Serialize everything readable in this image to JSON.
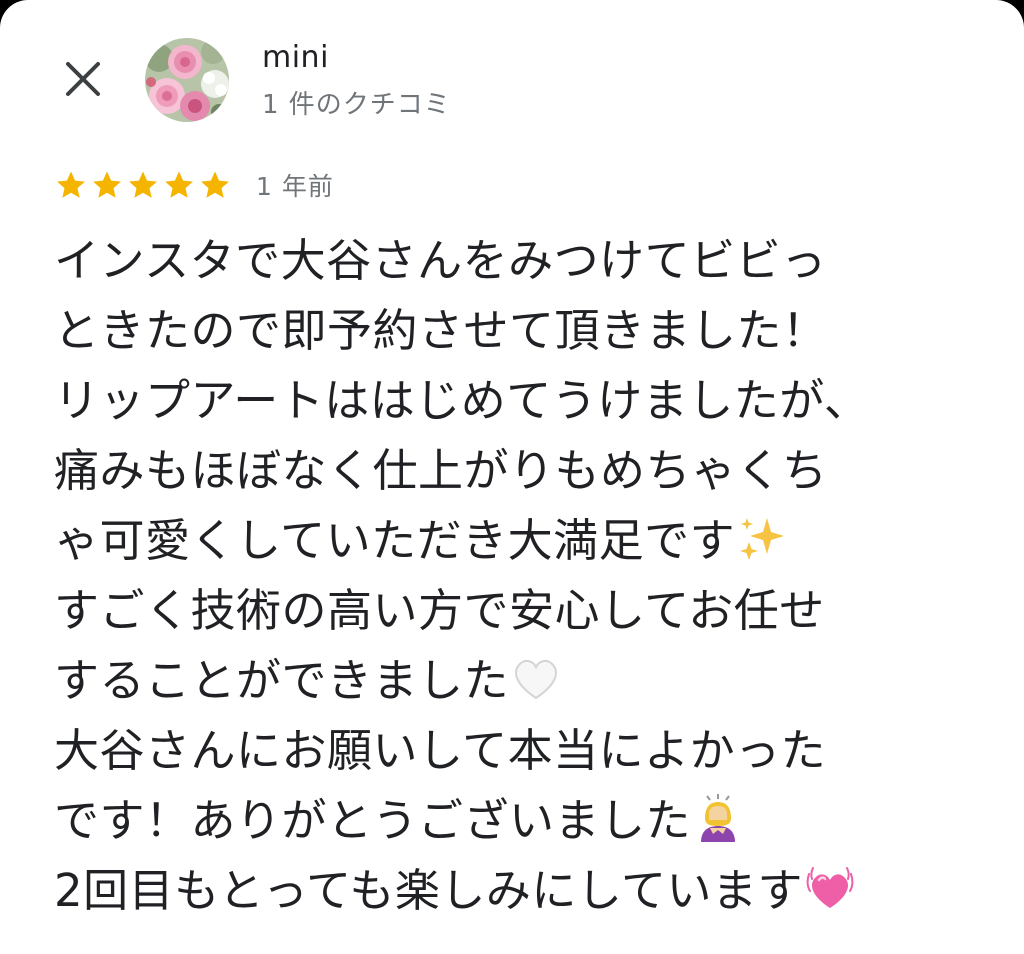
{
  "header": {
    "close_label": "close",
    "author_name": "mini",
    "review_count": "1 件のクチコミ"
  },
  "rating": {
    "stars": 5,
    "max": 5,
    "time_ago": "1 年前",
    "star_color": "#f4b400"
  },
  "review": {
    "lines": [
      "インスタで大谷さんをみつけてビビっ",
      "ときたので即予約させて頂きました！",
      "リップアートははじめてうけましたが、",
      "痛みもほぼなく仕上がりもめちゃくち",
      "ゃ可愛くしていただき大満足です",
      "すごく技術の高い方で安心してお任せ",
      "することができました",
      "大谷さんにお願いして本当によかった",
      "です！ありがとうございました",
      "2回目もとっても楽しみにしています"
    ],
    "emojis": [
      "sparkles-emoji",
      "white-heart-emoji",
      "bowing-woman-emoji",
      "beating-heart-emoji"
    ]
  }
}
